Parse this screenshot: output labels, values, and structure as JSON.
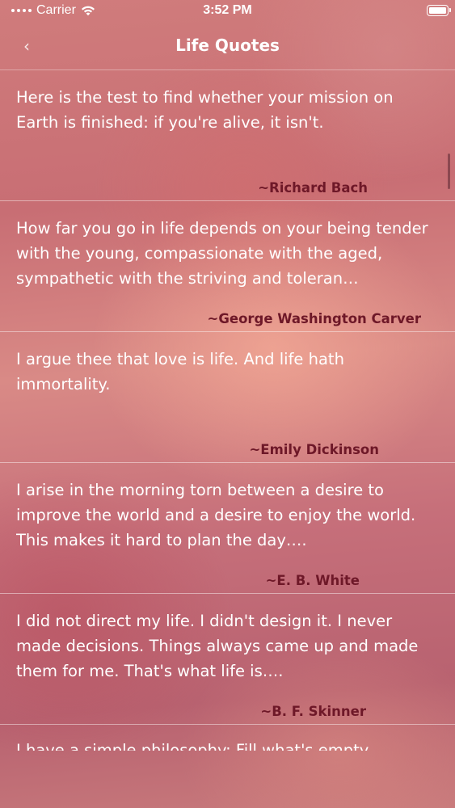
{
  "status_bar": {
    "carrier": "Carrier",
    "time": "3:52 PM"
  },
  "nav": {
    "back_label": "‹",
    "title": "Life Quotes"
  },
  "quotes": [
    {
      "text": "Here is the test to find whether your mission on Earth is finished: if you're alive, it isn't.",
      "author": "~Richard Bach"
    },
    {
      "text": "How far you go in life depends on your being tender with the young, compassionate with the aged, sympathetic with the striving and toleran…",
      "author": "~George Washington Carver"
    },
    {
      "text": "I argue thee that love is life. And life hath immortality.",
      "author": "~Emily Dickinson"
    },
    {
      "text": "I arise in the morning torn between a desire to improve the world and a desire to enjoy the world. This makes it hard to plan the day….",
      "author": "~E. B. White"
    },
    {
      "text": "I did not direct my life. I didn't design it. I never made decisions. Things always came up and made them for me. That's what life is….",
      "author": "~B. F. Skinner"
    }
  ],
  "partial_quote": {
    "text": "I have a simple philosophy: Fill what's empty."
  }
}
